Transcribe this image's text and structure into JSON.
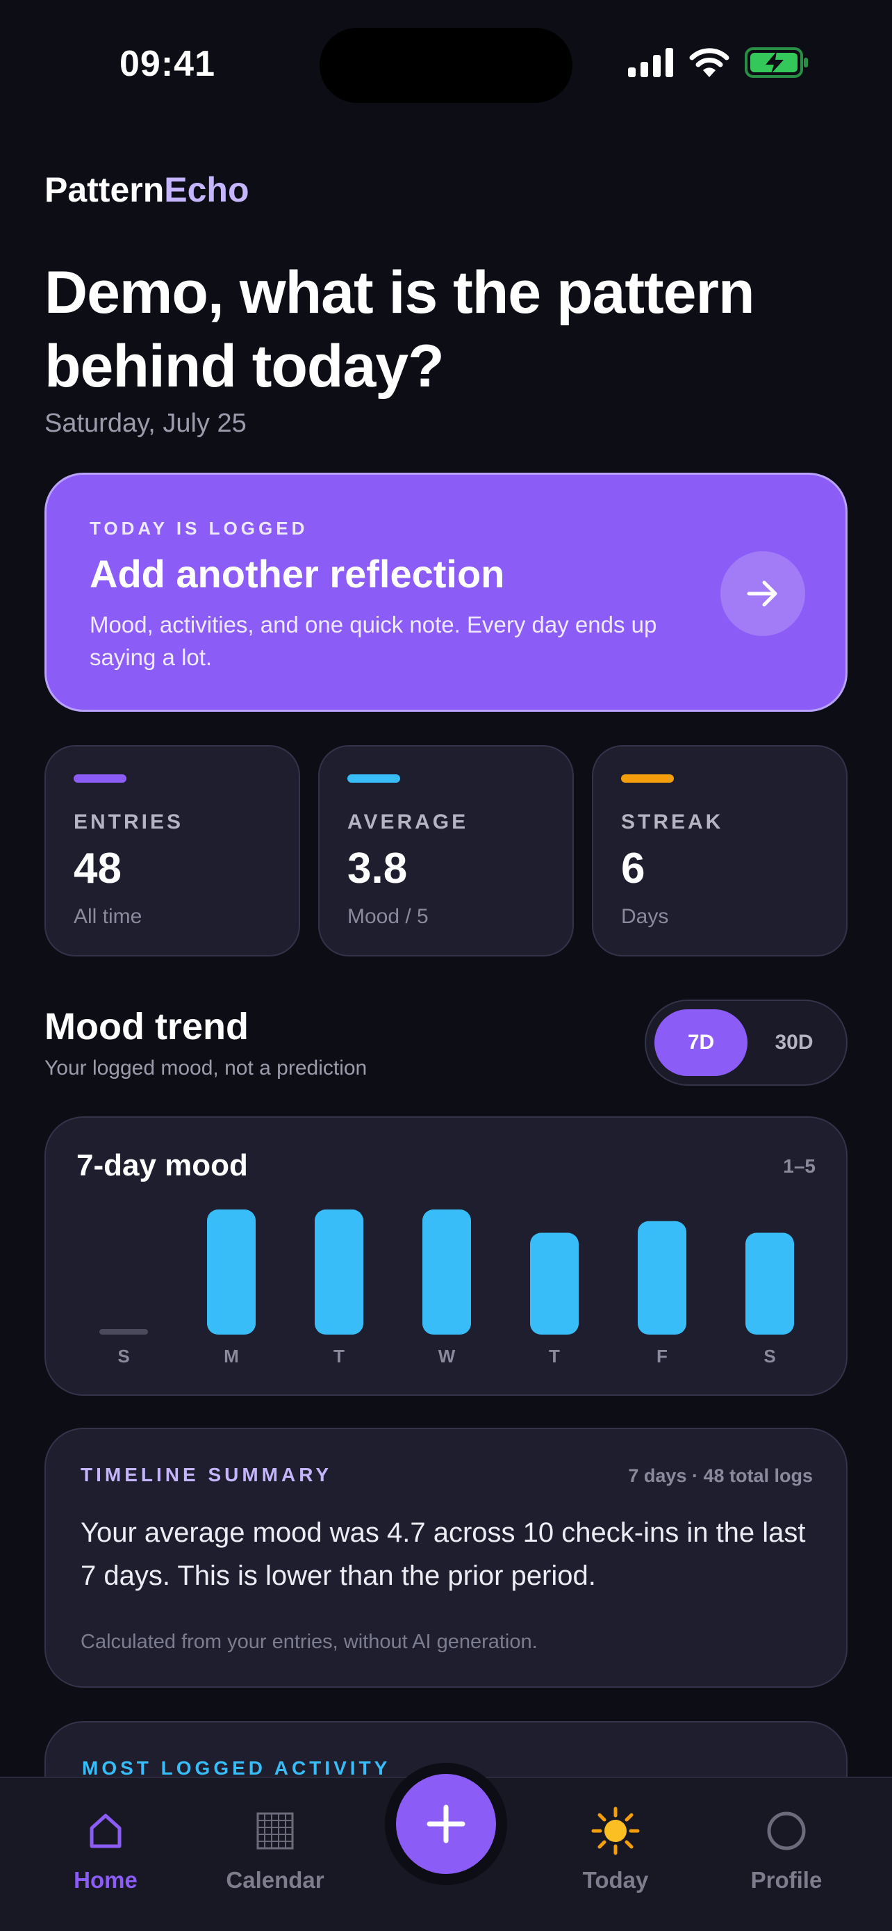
{
  "status_bar": {
    "time": "09:41"
  },
  "brand": {
    "part1": "Pattern",
    "part2": "Echo"
  },
  "header": {
    "headline": "Demo, what is the pattern behind today?",
    "date": "Saturday, July 25"
  },
  "hero": {
    "eyebrow": "TODAY IS LOGGED",
    "title": "Add another reflection",
    "description": "Mood, activities, and one quick note. Every day ends up saying a lot.",
    "icon": "arrow-right-icon"
  },
  "stats": [
    {
      "label": "ENTRIES",
      "value": "48",
      "sub": "All time",
      "color": "#8b5cf6"
    },
    {
      "label": "AVERAGE",
      "value": "3.8",
      "sub": "Mood / 5",
      "color": "#38bdf8"
    },
    {
      "label": "STREAK",
      "value": "6",
      "sub": "Days",
      "color": "#f59e0b"
    }
  ],
  "mood_trend": {
    "title": "Mood trend",
    "subtitle": "Your logged mood, not a prediction",
    "toggle": {
      "selected": "7D",
      "option_7d": "7D",
      "option_30d": "30D"
    }
  },
  "chart_card": {
    "title": "7-day mood",
    "range": "1–5"
  },
  "chart_data": {
    "type": "bar",
    "categories": [
      "S",
      "M",
      "T",
      "W",
      "T",
      "F",
      "S"
    ],
    "values": [
      null,
      5,
      5,
      5,
      4,
      4.5,
      4
    ],
    "ylim": [
      1,
      5
    ],
    "grid": false,
    "bar_color": "#38bdf8",
    "empty_color": "#4a4a5c"
  },
  "summary": {
    "eyebrow": "TIMELINE SUMMARY",
    "meta": "7 days · 48 total logs",
    "body": "Your average mood was 4.7 across 10 check-ins in the last 7 days. This is lower than the prior period.",
    "footnote": "Calculated from your entries, without AI generation."
  },
  "activity": {
    "eyebrow": "MOST LOGGED ACTIVITY"
  },
  "tabbar": {
    "tabs": [
      {
        "label": "Home",
        "icon": "home-icon",
        "active": true
      },
      {
        "label": "Calendar",
        "icon": "calendar-icon",
        "active": false
      },
      {
        "label": "Today",
        "icon": "sun-icon",
        "active": false
      },
      {
        "label": "Profile",
        "icon": "profile-icon",
        "active": false
      }
    ],
    "fab_icon": "plus-icon"
  },
  "colors": {
    "accent": "#8b5cf6",
    "cyan": "#38bdf8",
    "amber": "#f59e0b",
    "background": "#0d0d16"
  }
}
